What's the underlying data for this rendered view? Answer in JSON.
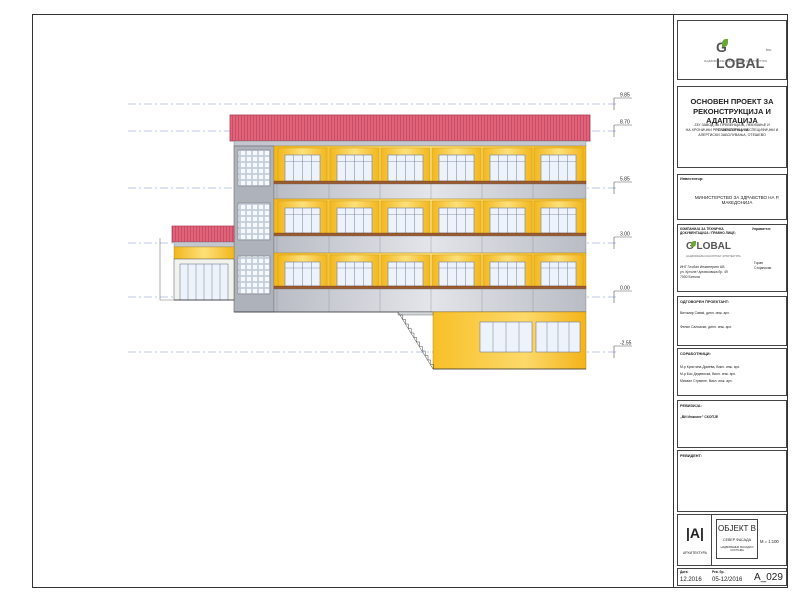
{
  "title_block": {
    "logo_top": {
      "text": "G LOBAL",
      "suffix": "Inc",
      "tagline": "НАДЗОРАНИЕ   КОНСУЛТИНГ   АРХИТЕКТУРА"
    },
    "project_title_1": "ОСНОВЕН ПРОЕКТ ЗА",
    "project_title_2": "РЕКОНСТРУКЦИЈА И АДАПТАЦИЈА",
    "project_desc": [
      "ЈЗУ ЗАВОД ЗА ПРЕВЕНЦИЈА, ЛЕКУВАЊЕ И РЕХАБИЛИТАЦИЈА",
      "НА ХРОНИЧНИ РЕСПИРАТОРНИ, НЕСПЕЦИФИЧНИ И",
      "АЛЕРГИСКИ ЗАБОЛУВАЊА, ОТЕШЕВО"
    ],
    "investor_label": "Инвеститор:",
    "investor_value": "МИНИСТЕРСТВО ЗА ЗДРАВСТВО НА Р. МАКЕДОНИЈА",
    "company_label": "КОМПАНИЈА ЗА ТЕХНИЧКА ДОКУМЕНТАЦИЈА / ПРАВНО ЛИЦЕ:",
    "manager_label": "Управител:",
    "logo_mid": {
      "text": "G LOBAL",
      "tagline": "НАДЗОРАНИЕ   КОНСУЛТИНГ   АРХИТЕКТУРА"
    },
    "company_address": [
      "ИНГ Глобал Инженеринг АВ",
      "ул. Кртолe Чуловсовска бр. 49",
      "7000 Битола"
    ],
    "manager_value": [
      "Горан",
      "Стојаноски"
    ],
    "responsible_label": "ОДГОВОРЕН ПРОЕКТАНТ:",
    "responsible_people": [
      "Витомир Савиќ, дипл. инж. арх.",
      "Фелип Салоаски, дипл. инж. арх."
    ],
    "collaborators_label": "СОРАБОТНИЦИ:",
    "collaborators": [
      "М-р Кристина Дрмева, Викл. инж. арх.",
      "М-р Бас Дедевоска, Викл. инж. арх.",
      "Михаил Стрмене, Викл. инж. арх."
    ],
    "revision_label": "РЕВИЗИЈА:",
    "revision_value": "„ВИ Инжсинг\" СКОПЈЕ",
    "reviewer_label": "РЕВИДЕНТ:",
    "discipline_code": "|A|",
    "discipline_name": "АРХИТЕКТУРА",
    "object_name": "ОБЈЕКТ В",
    "object_view": "СЕВЕР ФАСАДА",
    "object_sub": "НАДВОРЕШНИ ФАСАДИ И СОСТОЈБА",
    "scale": "М = 1:100",
    "date_label": "Дата:",
    "date_value": "12.2016",
    "rev_no_label": "Рев. бр.",
    "rev_no_value": "05-12/2016",
    "sheet_no": "A_029"
  },
  "levels": [
    {
      "label": "9.85"
    },
    {
      "label": "8.70"
    },
    {
      "label": "5.85"
    },
    {
      "label": "3.00"
    },
    {
      "label": "0.00"
    },
    {
      "label": "-2.55"
    }
  ],
  "colors": {
    "roof": "#e0637a",
    "roof_dark": "#b23a55",
    "wall_grey": "#c9ccd3",
    "yellow": "#f5c842",
    "yellow_light": "#fbe38a",
    "window_frame": "#d8e2f2",
    "window_glass": "#eef3fb",
    "balcony_rail": "#9c5b2e",
    "level_line": "#7b8fc9"
  }
}
